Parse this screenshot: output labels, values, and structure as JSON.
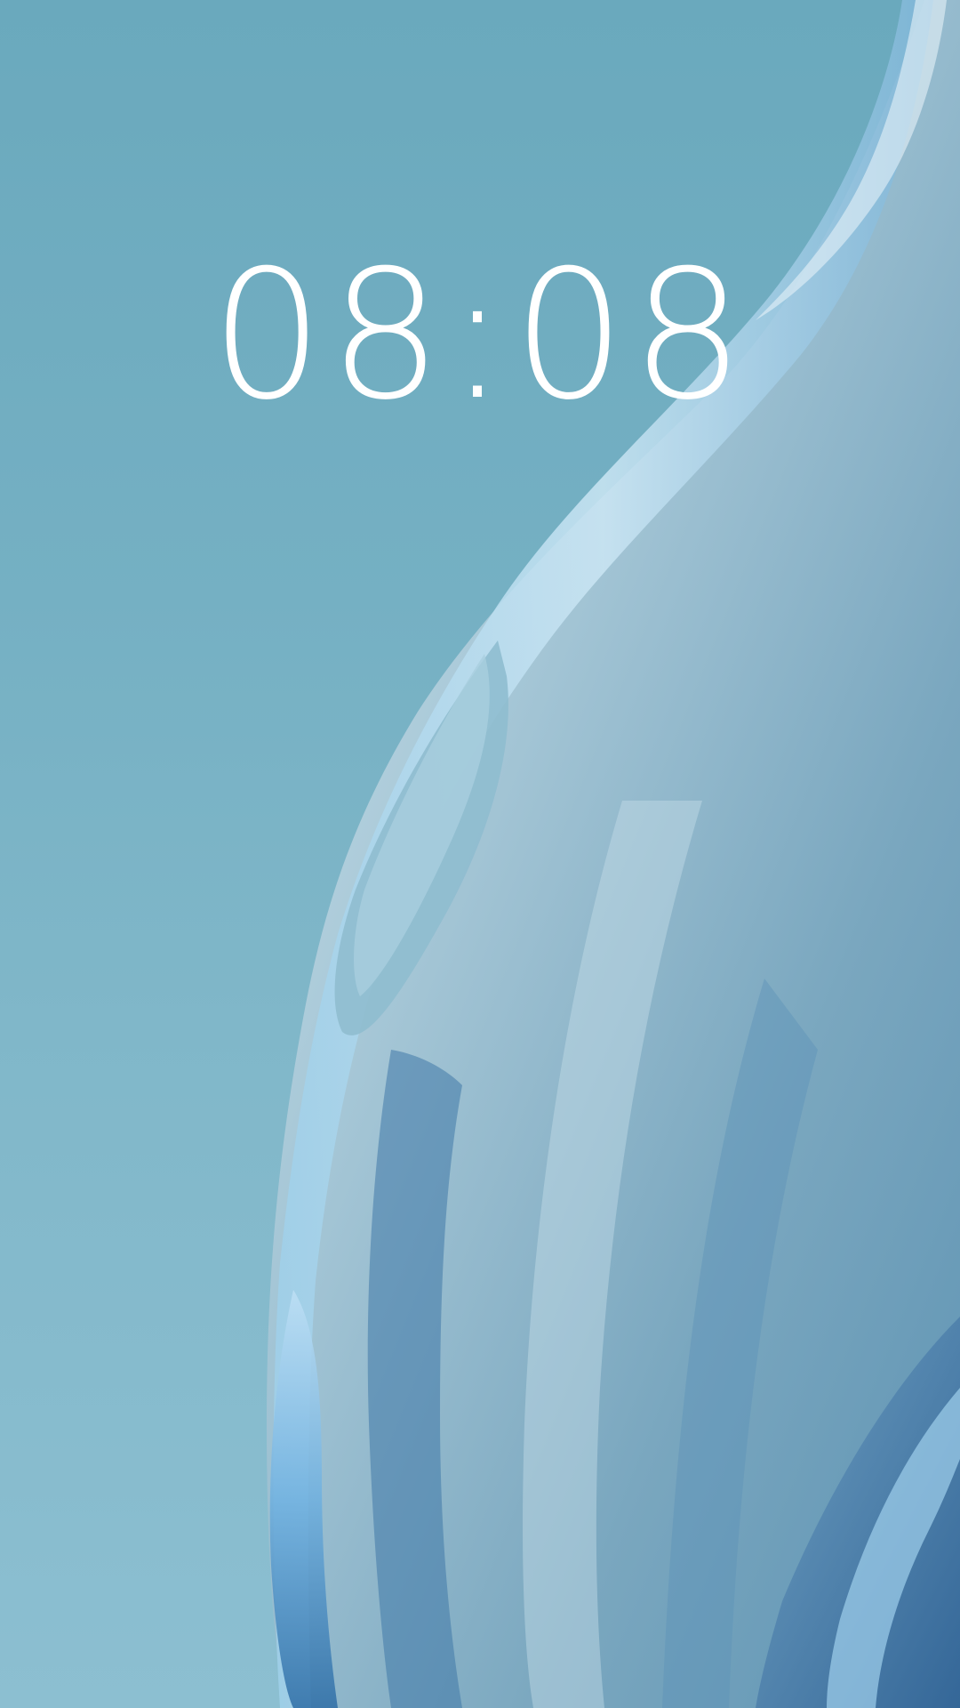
{
  "lockscreen": {
    "clock": {
      "time": "08:08"
    },
    "wallpaper": {
      "icon": "abstract-liquid-wave-wallpaper"
    }
  },
  "colors": {
    "background_top": "#6aa9bd",
    "background_bottom": "#8cbfd1",
    "wave_light": "#cfe3ee",
    "wave_mid": "#7fb3d6",
    "wave_deep": "#3f78a8",
    "clock_text": "#ffffff"
  }
}
